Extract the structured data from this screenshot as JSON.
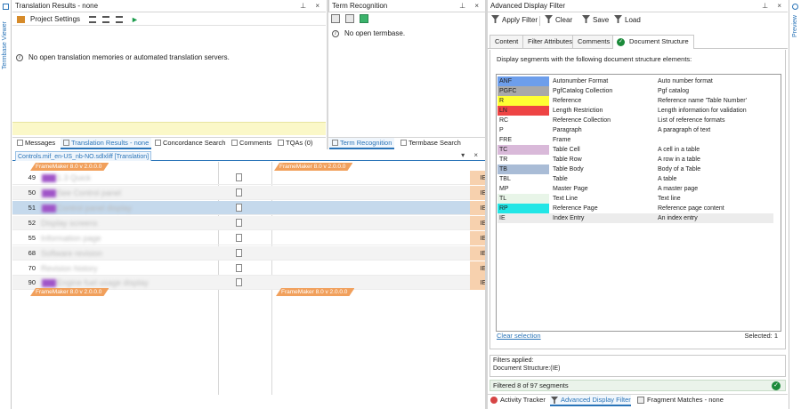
{
  "side": {
    "left_label": "Termbase Viewer",
    "right_label": "Preview"
  },
  "translation_results": {
    "title": "Translation Results - none",
    "project_settings": "Project Settings",
    "message": "No open translation memories or automated translation servers."
  },
  "term_recognition": {
    "title": "Term Recognition",
    "message": "No open termbase."
  },
  "left_tabs": [
    "Messages",
    "Translation Results - none",
    "Concordance Search",
    "Comments",
    "TQAs (0)"
  ],
  "mid_tabs": [
    "Term Recognition",
    "Termbase Search"
  ],
  "editor": {
    "doc_tab": "Controls.mif_en-US_nb-NO.sdlxliff [Translation]",
    "tag_label": "FrameMaker 8.0 v 2.0.0.0",
    "rows": [
      {
        "num": "49",
        "src": "1.3 Quick",
        "ie": "IE"
      },
      {
        "num": "50",
        "src": "See Control panel",
        "ie": "IE"
      },
      {
        "num": "51",
        "src": "Control panel display",
        "ie": "IE"
      },
      {
        "num": "52",
        "src": "Display screens",
        "ie": "IE"
      },
      {
        "num": "55",
        "src": "Information page",
        "ie": "IE"
      },
      {
        "num": "68",
        "src": "Software revision",
        "ie": "IE"
      },
      {
        "num": "70",
        "src": "Revision history",
        "ie": "IE"
      },
      {
        "num": "90",
        "src": "Engine fuel usage display",
        "ie": "IE"
      }
    ]
  },
  "adf": {
    "title": "Advanced Display Filter",
    "toolbar": {
      "apply": "Apply Filter",
      "clear": "Clear",
      "save": "Save",
      "load": "Load"
    },
    "tabs": [
      "Content",
      "Filter Attributes",
      "Comments",
      "Document Structure"
    ],
    "heading": "Display segments with the following document structure elements:",
    "items": [
      {
        "code": "ANF",
        "name": "Autonumber Format",
        "desc": "Auto number format",
        "color": "#6d9eeb"
      },
      {
        "code": "PGFC",
        "name": "PgfCatalog Collection",
        "desc": "Pgf catalog",
        "color": "#a9a9a9"
      },
      {
        "code": "R",
        "name": "Reference",
        "desc": "Reference name 'Table Number'",
        "color": "#ffff33"
      },
      {
        "code": "LN",
        "name": "Length Restriction",
        "desc": "Length information for validation",
        "color": "#ee4444"
      },
      {
        "code": "RC",
        "name": "Reference Collection",
        "desc": "List of reference formats",
        "color": ""
      },
      {
        "code": "P",
        "name": "Paragraph",
        "desc": "A paragraph of text",
        "color": ""
      },
      {
        "code": "FRE",
        "name": "Frame",
        "desc": "",
        "color": ""
      },
      {
        "code": "TC",
        "name": "Table Cell",
        "desc": "A cell in a table",
        "color": "#d9b9d9"
      },
      {
        "code": "TR",
        "name": "Table Row",
        "desc": "A row in a table",
        "color": ""
      },
      {
        "code": "TB",
        "name": "Table Body",
        "desc": "Body of a Table",
        "color": "#a9bcd6"
      },
      {
        "code": "TBL",
        "name": "Table",
        "desc": "A table",
        "color": ""
      },
      {
        "code": "MP",
        "name": "Master Page",
        "desc": "A master page",
        "color": ""
      },
      {
        "code": "TL",
        "name": "Text Line",
        "desc": "Text line",
        "color": "#e8f5e8"
      },
      {
        "code": "RP",
        "name": "Reference Page",
        "desc": "Reference page content",
        "color": "#22e6e6"
      },
      {
        "code": "IE",
        "name": "Index Entry",
        "desc": "An index entry",
        "color": "",
        "selected": true
      }
    ],
    "clear_selection": "Clear selection",
    "selected": "Selected: 1",
    "filters_applied_label": "Filters applied:",
    "filters_applied_value": "Document Structure:(IE)",
    "filtered_status": "Filtered 8 of 97 segments"
  },
  "bottom_tabs": [
    "Activity Tracker",
    "Advanced Display Filter",
    "Fragment Matches - none"
  ]
}
